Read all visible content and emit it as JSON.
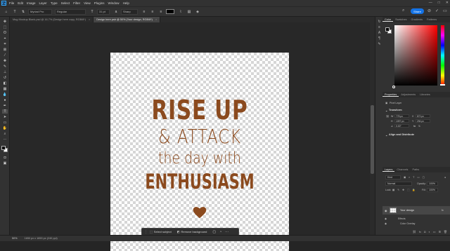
{
  "menubar": {
    "logo": "Ps",
    "items": [
      "File",
      "Edit",
      "Image",
      "Layer",
      "Type",
      "Select",
      "Filter",
      "View",
      "Plugins",
      "Window",
      "Help"
    ],
    "window_controls": [
      "—",
      "□",
      "✕"
    ]
  },
  "options": {
    "font_family": "Myriad Pro",
    "font_style": "Regular",
    "font_size": "31 pt",
    "anti_alias": "Sharp",
    "text_color": "#000000",
    "share_label": "Share"
  },
  "tabs": [
    {
      "label": "Mug Mockup Blank.psd @ 16.7% (Design here copy, RGB/8*)",
      "active": false
    },
    {
      "label": "Design here.psb @ 50% (Your design, RGB/8*)",
      "active": true
    }
  ],
  "artwork": {
    "line1": "RISE UP",
    "line2": "& ATTACK",
    "line3": "the day with",
    "line4": "ENTHUSIASM",
    "color": "#8b4a1e"
  },
  "contextbar": {
    "select_subject": "Select subject",
    "remove_background": "Remove background"
  },
  "status": {
    "zoom": "50%",
    "doc_info": "1650 px x 1890 px (240 ppi)"
  },
  "color_panel": {
    "tabs": [
      "Color",
      "Swatches",
      "Gradients",
      "Patterns"
    ],
    "foreground": "#000000",
    "background": "#ffffff"
  },
  "properties_panel": {
    "tabs": [
      "Properties",
      "Adjustments",
      "Libraries"
    ],
    "layer_type": "Pixel Layer",
    "transform_title": "Transform",
    "w": "778 px",
    "h": "1097 px",
    "x": "872 px",
    "y": "294 px",
    "angle": "0.00°",
    "align_title": "Align and Distribute"
  },
  "layers_panel": {
    "tabs": [
      "Layers",
      "Channels",
      "Paths"
    ],
    "filter_kind": "Kind",
    "blend_mode": "Normal",
    "opacity_label": "Opacity:",
    "opacity_value": "100%",
    "lock_label": "Lock:",
    "fill_label": "Fill:",
    "fill_value": "100%",
    "layer_name": "Your design",
    "effects_label": "Effects",
    "color_overlay_label": "Color Overlay"
  }
}
